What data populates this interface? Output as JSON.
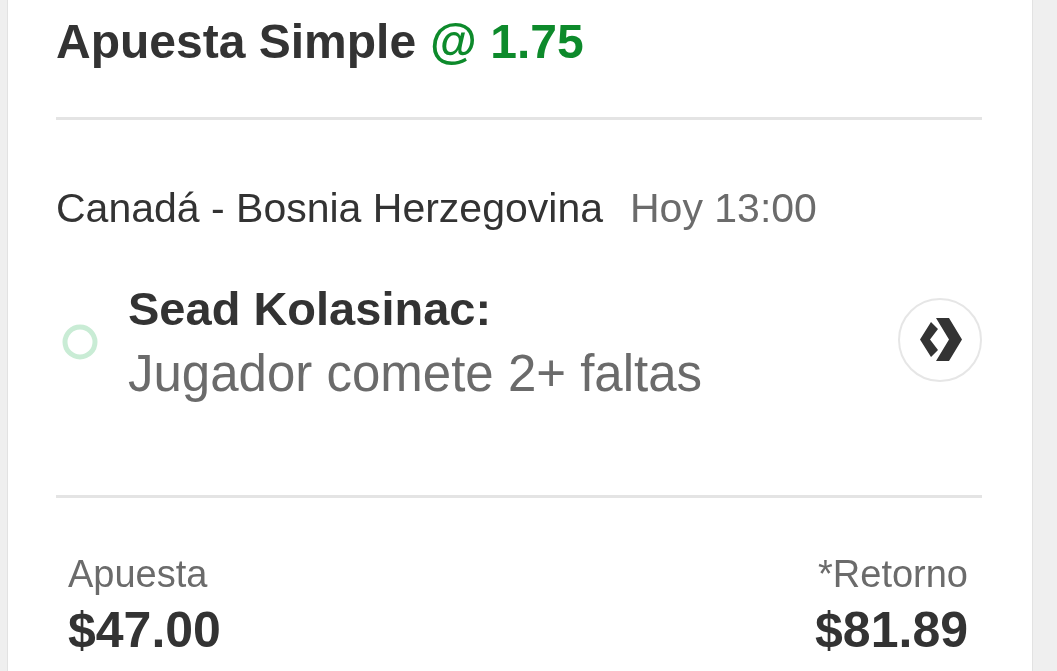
{
  "bet": {
    "title": "Apuesta Simple",
    "odds": "@ 1.75"
  },
  "event": {
    "match": "Canadá - Bosnia Herzegovina",
    "time": "Hoy 13:00"
  },
  "selection": {
    "player": "Sead Kolasinac:",
    "market": "Jugador comete 2+ faltas"
  },
  "totals": [
    {
      "label": "Apuesta",
      "amount": "$47.00"
    },
    {
      "label": "*Retorno",
      "amount": "$81.89"
    }
  ]
}
